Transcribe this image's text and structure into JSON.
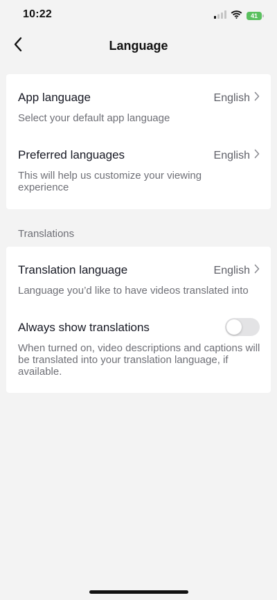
{
  "status_bar": {
    "time": "10:22",
    "battery": "41",
    "battery_color": "#5ac05f"
  },
  "header": {
    "title": "Language",
    "back_icon": "chevron-left-icon"
  },
  "sections": [
    {
      "header": "",
      "rows": [
        {
          "title": "App language",
          "value": "English",
          "description": "Select your default app language"
        },
        {
          "title": "Preferred languages",
          "value": "English",
          "description": "This will help us customize your viewing experience"
        }
      ]
    },
    {
      "header": "Translations",
      "rows": [
        {
          "title": "Translation language",
          "value": "English",
          "description": "Language you’d like to have videos translated into"
        },
        {
          "title": "Always show translations",
          "toggle_on": false,
          "description": "When turned on, video descriptions and captions will be translated into your translation language, if available."
        }
      ]
    }
  ],
  "colors": {
    "background": "#f3f3f3",
    "card": "#ffffff",
    "toggle_off": "#e3e3e5"
  }
}
